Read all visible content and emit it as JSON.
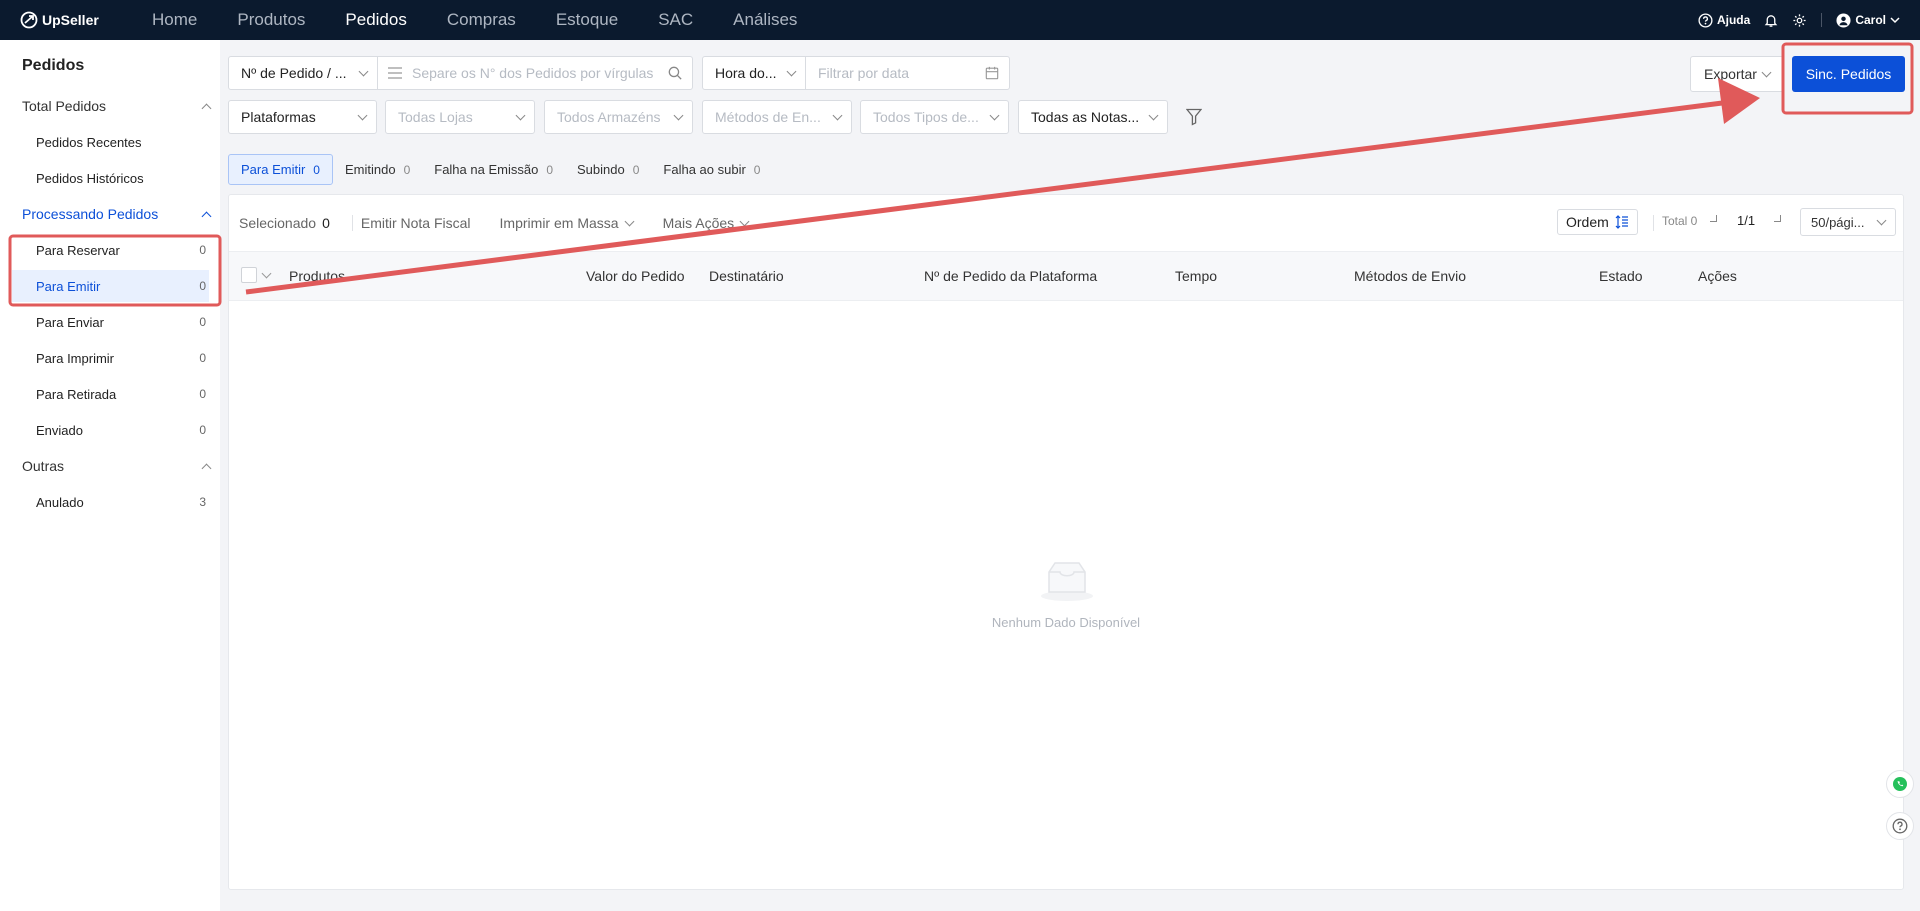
{
  "topbar": {
    "brand": "UpSeller",
    "nav": [
      "Home",
      "Produtos",
      "Pedidos",
      "Compras",
      "Estoque",
      "SAC",
      "Análises"
    ],
    "help_label": "Ajuda",
    "user_name": "Carol"
  },
  "sidebar": {
    "title": "Pedidos",
    "group_total": "Total Pedidos",
    "recent": "Pedidos Recentes",
    "history": "Pedidos Históricos",
    "group_processing": "Processando Pedidos",
    "items": [
      {
        "label": "Para Reservar",
        "count": "0"
      },
      {
        "label": "Para Emitir",
        "count": "0"
      },
      {
        "label": "Para Enviar",
        "count": "0"
      },
      {
        "label": "Para Imprimir",
        "count": "0"
      },
      {
        "label": "Para Retirada",
        "count": "0"
      },
      {
        "label": "Enviado",
        "count": "0"
      }
    ],
    "group_other": "Outras",
    "cancelled": {
      "label": "Anulado",
      "count": "3"
    }
  },
  "filters": {
    "order_number_select": "Nº de Pedido / ...",
    "order_search_placeholder": "Separe os N° dos Pedidos por vírgulas",
    "time_select": "Hora do...",
    "date_placeholder": "Filtrar por data",
    "platforms": "Plataformas",
    "stores": "Todas Lojas",
    "warehouses": "Todos Armazéns",
    "shipping_methods": "Métodos de En...",
    "types": "Todos Tipos de...",
    "invoices": "Todas as Notas..."
  },
  "actions": {
    "export": "Exportar",
    "sync": "Sinc. Pedidos"
  },
  "tabs": [
    {
      "label": "Para Emitir",
      "count": "0"
    },
    {
      "label": "Emitindo",
      "count": "0"
    },
    {
      "label": "Falha na Emissão",
      "count": "0"
    },
    {
      "label": "Subindo",
      "count": "0"
    },
    {
      "label": "Falha ao subir",
      "count": "0"
    }
  ],
  "toolbar": {
    "selected_label": "Selecionado",
    "selected_count": "0",
    "emit_invoice": "Emitir Nota Fiscal",
    "mass_print": "Imprimir em Massa",
    "more_actions": "Mais Ações",
    "order": "Ordem",
    "total": "Total 0",
    "page": "1/1",
    "per_page": "50/pági..."
  },
  "table": {
    "columns": [
      "Produtos",
      "Valor do Pedido",
      "Destinatário",
      "Nº de Pedido da Plataforma",
      "Tempo",
      "Métodos de Envio",
      "Estado",
      "Ações"
    ],
    "empty_text": "Nenhum Dado Disponível"
  },
  "colors": {
    "primary": "#0c50d8",
    "topbar": "#0b1a2e",
    "annotation": "#e05a5a"
  }
}
